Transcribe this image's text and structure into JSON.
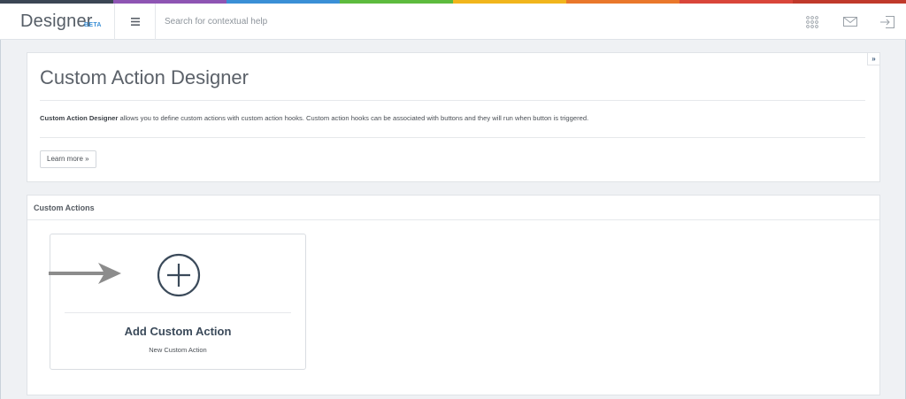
{
  "header": {
    "brand": "Designer",
    "brand_badge": "BETA",
    "search_placeholder": "Search for contextual help",
    "strip_colors": [
      "#3b4654",
      "#8e55b3",
      "#3a8fd6",
      "#5dbb3e",
      "#f1b51c",
      "#e9772b",
      "#d9463a",
      "#c0392b"
    ],
    "icons": [
      "menu-icon",
      "apps-grid-icon",
      "mail-icon",
      "logout-icon"
    ]
  },
  "intro": {
    "title": "Custom Action Designer",
    "desc_bold": "Custom Action Designer",
    "desc_rest": " allows you to define custom actions with custom action hooks. Custom action hooks can be associated with buttons and they will run when button is triggered.",
    "learn_more": "Learn more »",
    "collapse_label": "»"
  },
  "actions": {
    "title": "Custom Actions",
    "card": {
      "title": "Add Custom Action",
      "subtitle": "New Custom Action"
    }
  }
}
